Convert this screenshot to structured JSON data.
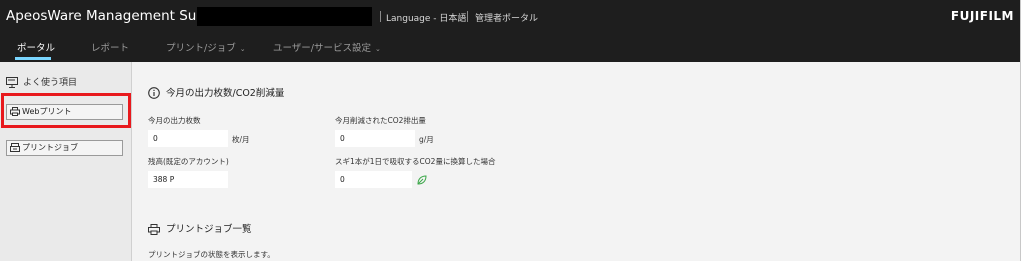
{
  "header": {
    "app_title": "ApeosWare Management Suite",
    "language": "Language - 日本語",
    "admin_portal": "管理者ポータル",
    "brand": "FUJIFILM"
  },
  "nav": {
    "tabs": [
      {
        "label": "ポータル",
        "active": true
      },
      {
        "label": "レポート",
        "active": false
      },
      {
        "label": "プリント/ジョブ",
        "active": false,
        "dropdown": true
      },
      {
        "label": "ユーザー/サービス設定",
        "active": false,
        "dropdown": true
      }
    ],
    "caret": "⌄"
  },
  "sidebar": {
    "heading": "よく使う項目",
    "items": [
      {
        "label": "Webプリント",
        "icon": "printer-icon"
      },
      {
        "label": "プリントジョブ",
        "icon": "print-job-icon"
      }
    ]
  },
  "monthly": {
    "title": "今月の出力枚数/CO2削減量",
    "output_label": "今月の出力枚数",
    "output_value": "0",
    "output_unit": "枚/月",
    "co2_label": "今月削減されたCO2排出量",
    "co2_value": "0",
    "co2_unit": "g/月",
    "balance_label": "残高(既定のアカウント)",
    "balance_value": "388 P",
    "cedar_label": "スギ1本が1日で吸収するCO2量に換算した場合",
    "cedar_value": "0"
  },
  "joblist": {
    "title": "プリントジョブ一覧",
    "description": "プリントジョブの状態を表示します。"
  },
  "colors": {
    "header_bg": "#1e1e1e",
    "accent": "#7ad6ff",
    "highlight": "#e8191d",
    "leaf": "#3aa648"
  }
}
